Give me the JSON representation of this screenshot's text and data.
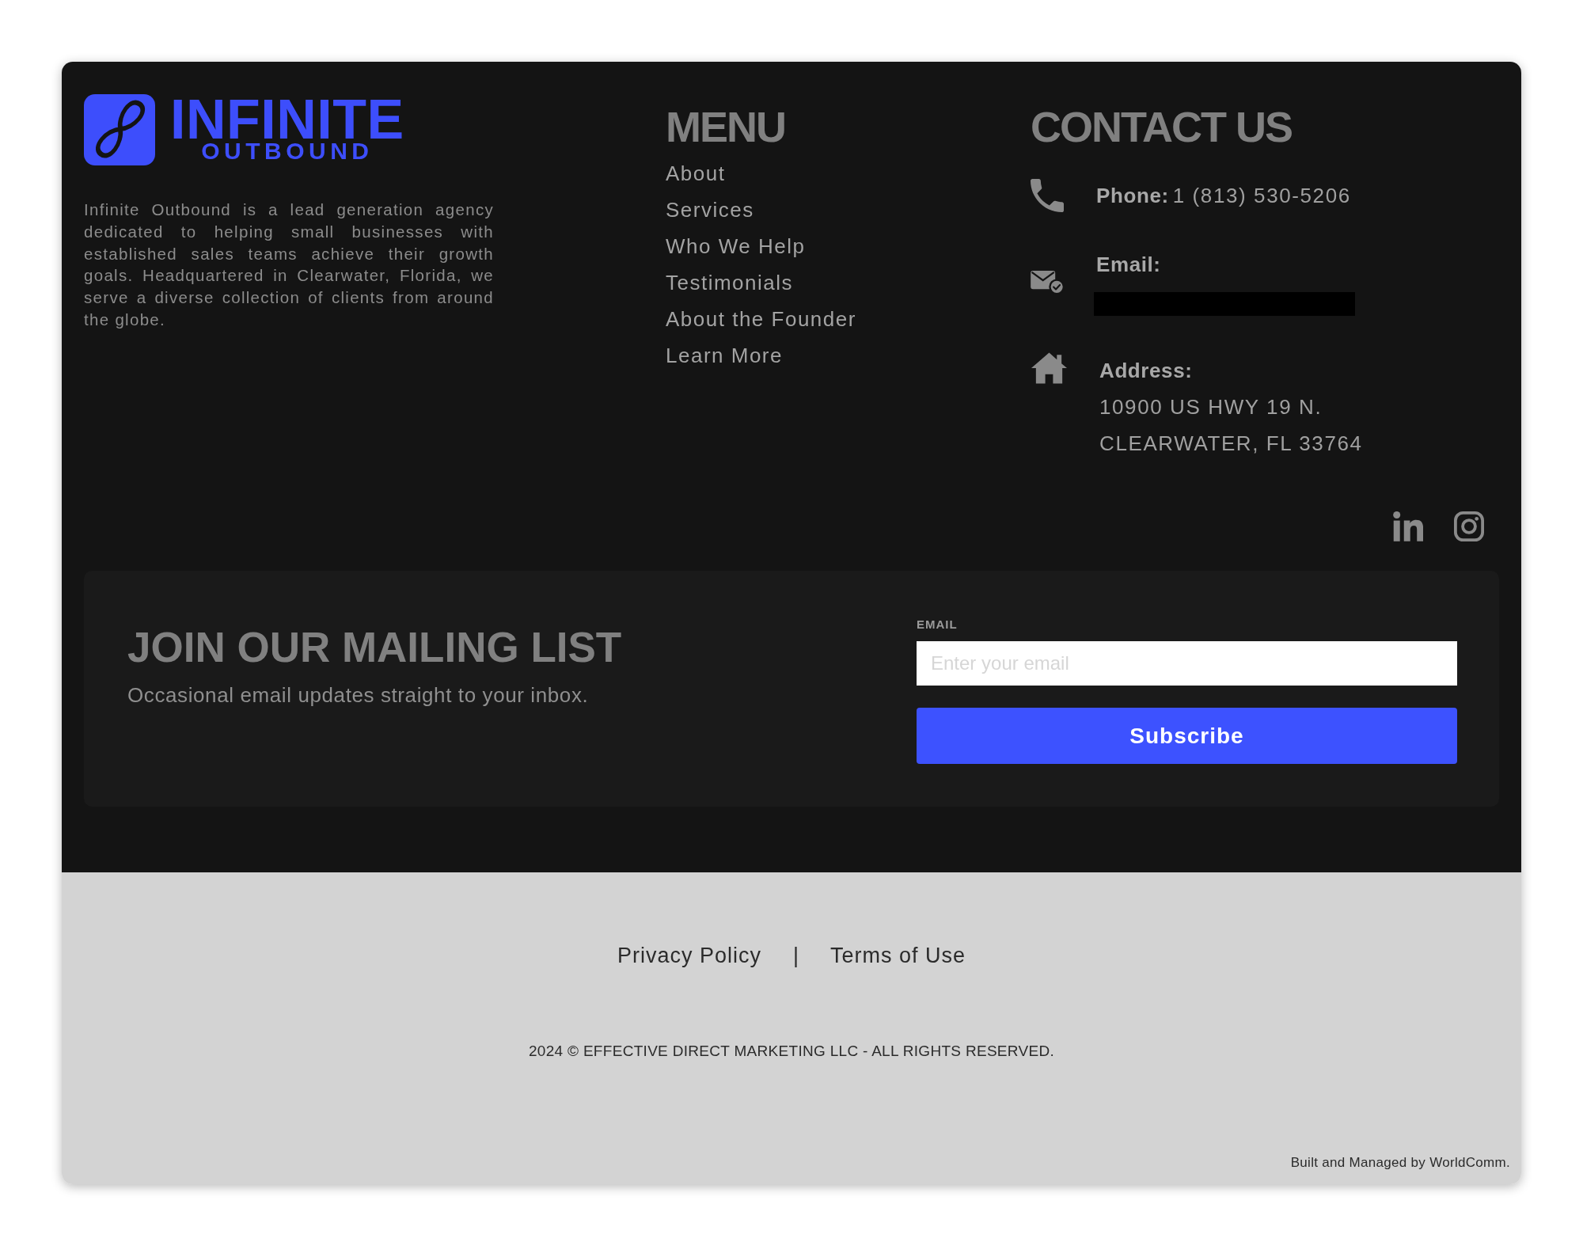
{
  "brand": {
    "name": "INFINITE",
    "subname": "OUTBOUND",
    "description": "Infinite Outbound is a lead generation agency dedicated to helping small businesses with established sales teams achieve their growth goals. Headquartered in Clearwater, Florida, we serve a diverse collection of clients from around the globe."
  },
  "menu": {
    "title": "MENU",
    "items": [
      "About",
      "Services",
      "Who We Help",
      "Testimonials",
      "About the Founder",
      "Learn More"
    ]
  },
  "contact": {
    "title": "CONTACT US",
    "items": [
      {
        "kind": "phone",
        "label": "Phone:",
        "value": "1 (813) 530-5206"
      },
      {
        "kind": "email",
        "label": "Email:",
        "redacted": true
      },
      {
        "kind": "address",
        "label": "Address:",
        "lines": [
          "10900 US HWY 19 N.",
          "CLEARWATER, FL 33764"
        ]
      }
    ]
  },
  "mailing_list": {
    "title": "JOIN OUR MAILING LIST",
    "subtitle": "Occasional email updates straight to your inbox.",
    "field_label": "EMAIL",
    "placeholder": "Enter your email",
    "button": "Subscribe"
  },
  "legal_links": [
    "Privacy Policy",
    "Terms of Use"
  ],
  "separator": "|",
  "copyright": "2024 © EFFECTIVE DIRECT MARKETING LLC - ALL RIGHTS RESERVED.",
  "credit": "Built and Managed by WorldComm."
}
